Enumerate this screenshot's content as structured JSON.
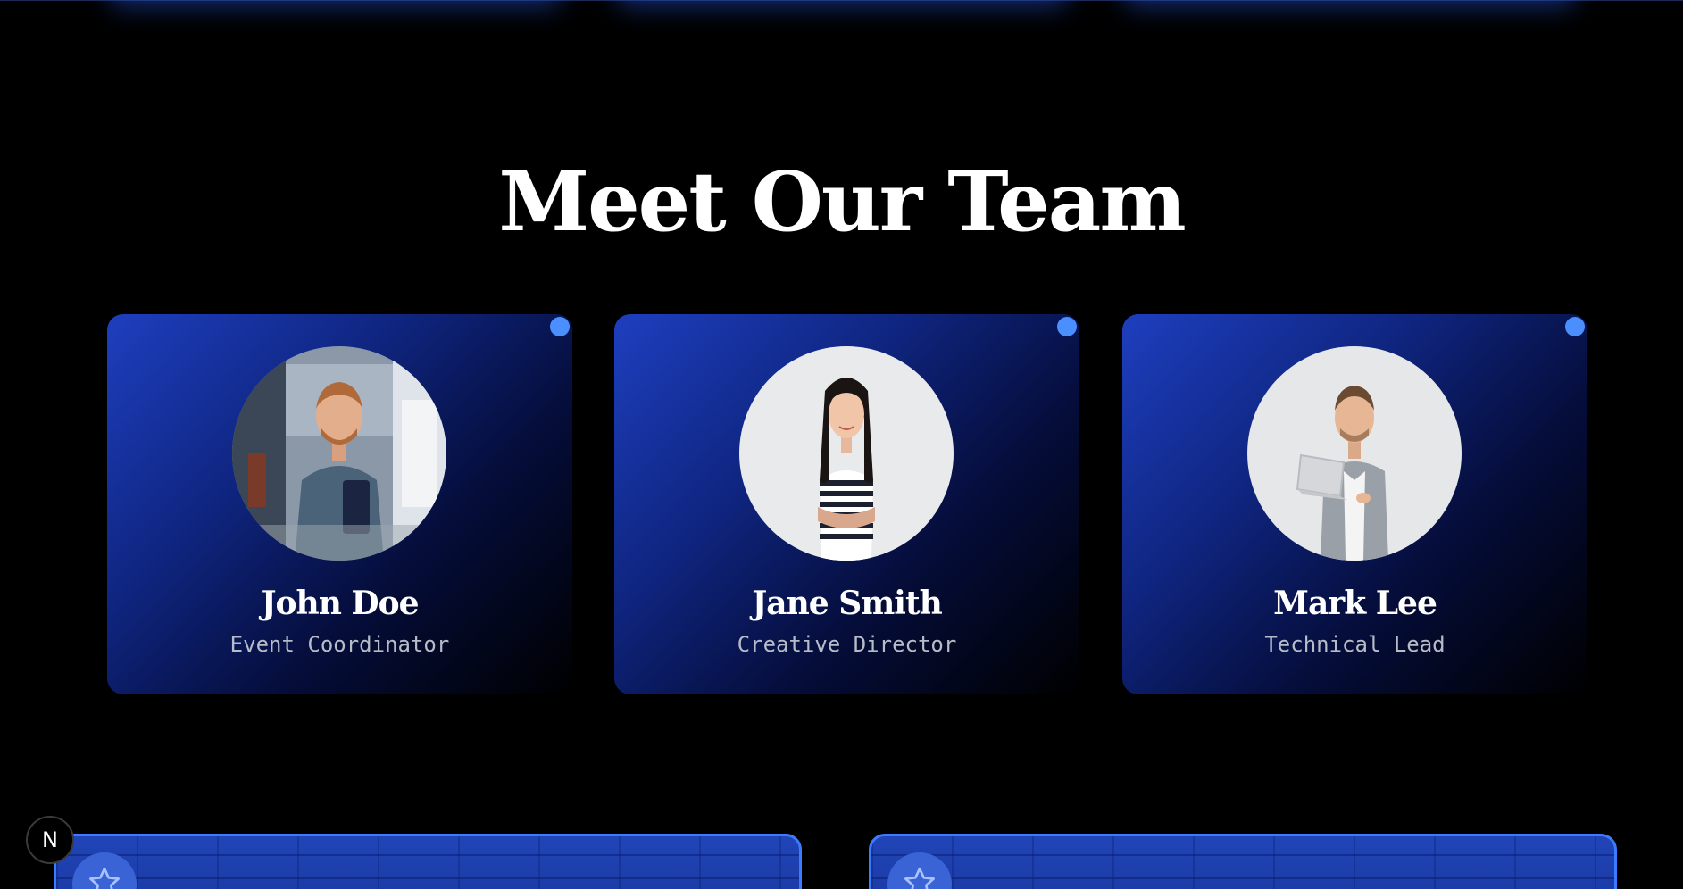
{
  "section": {
    "title": "Meet Our Team"
  },
  "team": [
    {
      "name": "John Doe",
      "role": "Event Coordinator"
    },
    {
      "name": "Jane Smith",
      "role": "Creative Director"
    },
    {
      "name": "Mark Lee",
      "role": "Technical Lead"
    }
  ],
  "floating_button": {
    "label": "N"
  },
  "colors": {
    "background": "#000000",
    "card_gradient_start": "#1e3fbf",
    "accent_dot": "#4b8fff",
    "bottom_card_border": "#3b7bff"
  },
  "icons": {
    "bottom_card_badge": "star-icon",
    "status_indicator": "dot-icon"
  }
}
